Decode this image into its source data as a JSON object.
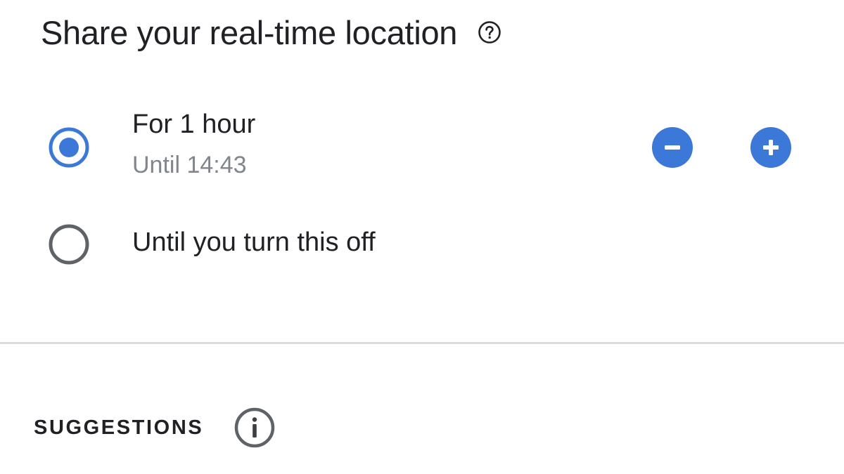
{
  "header": {
    "title": "Share your real-time location",
    "help_icon": "help-circle-icon"
  },
  "duration_options": [
    {
      "label": "For 1 hour",
      "sublabel": "Until 14:43",
      "selected": true,
      "radio_icon": "radio-checked-icon"
    },
    {
      "label": "Until you turn this off",
      "selected": false,
      "radio_icon": "radio-unchecked-icon"
    }
  ],
  "stepper": {
    "decrease_icon": "minus-circle-icon",
    "increase_icon": "plus-circle-icon"
  },
  "suggestions": {
    "title": "SUGGESTIONS",
    "info_icon": "info-icon"
  },
  "colors": {
    "accent": "#3c78d8",
    "text_primary": "#202124",
    "text_secondary": "#80868b",
    "radio_unselected": "#5f6368",
    "divider": "#dadce0"
  }
}
